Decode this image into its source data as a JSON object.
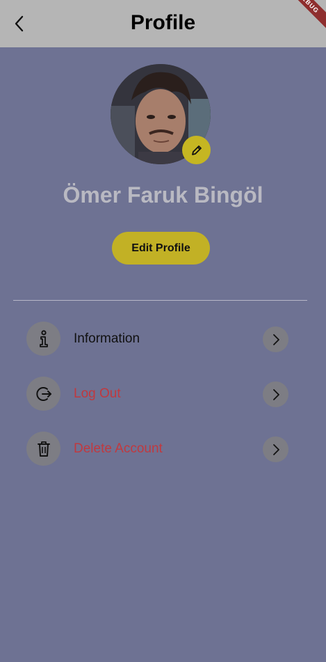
{
  "app_bar": {
    "title": "Profile",
    "debug_banner": "DEBUG"
  },
  "profile": {
    "name": "Ömer Faruk Bingöl",
    "edit_profile_label": "Edit Profile"
  },
  "menu": [
    {
      "label": "Information",
      "icon": "info-icon",
      "color": "#111111"
    },
    {
      "label": "Log Out",
      "icon": "logout-icon",
      "color": "#c0393f"
    },
    {
      "label": "Delete Account",
      "icon": "trash-icon",
      "color": "#c0393f"
    }
  ],
  "colors": {
    "background": "#6e7293",
    "app_bar": "#b5b5b5",
    "accent": "#c2b125",
    "danger": "#c0393f"
  }
}
